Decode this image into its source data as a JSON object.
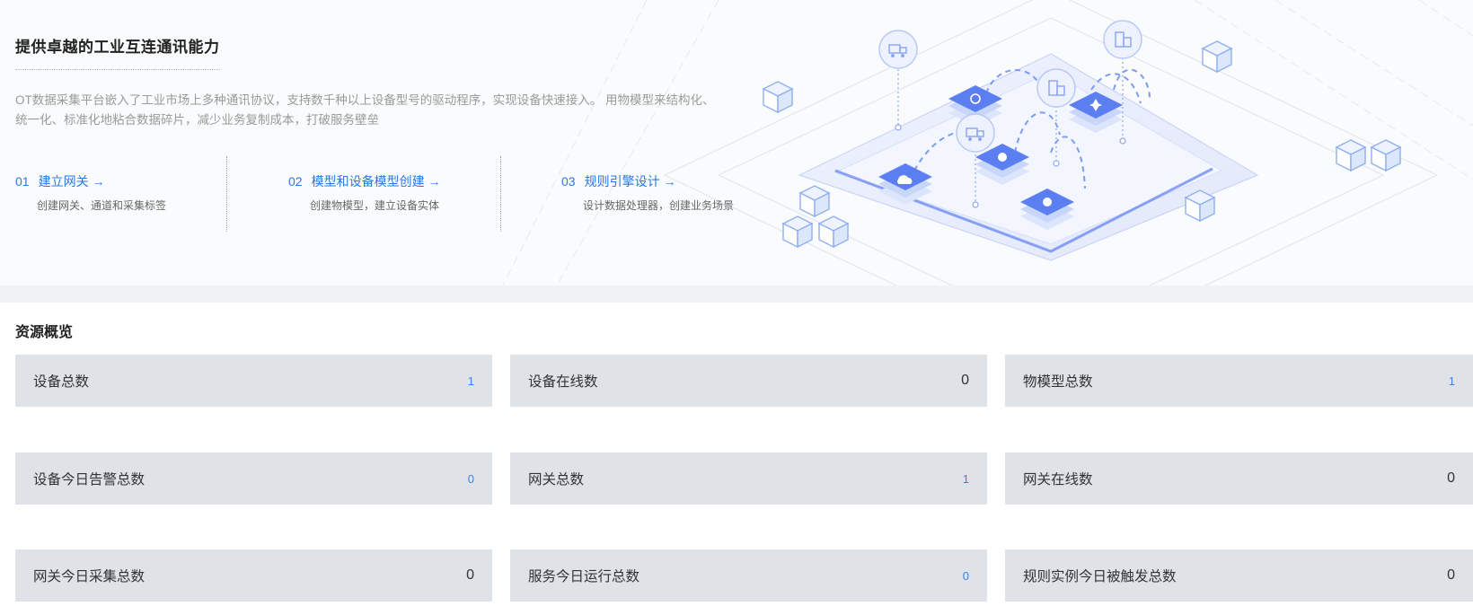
{
  "hero": {
    "title": "提供卓越的工业互连通讯能力",
    "description": "OT数据采集平台嵌入了工业市场上多种通讯协议，支持数千种以上设备型号的驱动程序，实现设备快速接入。 用物模型来结构化、统一化、标准化地粘合数据碎片，减少业务复制成本，打破服务壁垒",
    "steps": [
      {
        "num": "01",
        "title": "建立网关 →",
        "sub": "创建网关、通道和采集标签"
      },
      {
        "num": "02",
        "title": "模型和设备模型创建 →",
        "sub": "创建物模型，建立设备实体"
      },
      {
        "num": "03",
        "title": "规则引擎设计 →",
        "sub": "设计数据处理器，创建业务场景"
      }
    ]
  },
  "overview": {
    "title": "资源概览",
    "cards": [
      {
        "label": "设备总数",
        "value": "1",
        "blue": true
      },
      {
        "label": "设备在线数",
        "value": "0",
        "blue": false
      },
      {
        "label": "物模型总数",
        "value": "1",
        "blue": true
      },
      {
        "label": "设备今日告警总数",
        "value": "0",
        "blue": true
      },
      {
        "label": "网关总数",
        "value": "1",
        "blue": true
      },
      {
        "label": "网关在线数",
        "value": "0",
        "blue": false
      },
      {
        "label": "网关今日采集总数",
        "value": "0",
        "blue": false
      },
      {
        "label": "服务今日运行总数",
        "value": "0",
        "blue": true
      },
      {
        "label": "规则实例今日被触发总数",
        "value": "0",
        "blue": false
      }
    ]
  },
  "colors": {
    "accent": "#2a78e4",
    "card_bg": "#dfe2e6",
    "platform_blue": "#5b7ff0"
  },
  "icons": [
    "truck-icon",
    "building-icon",
    "bell-icon",
    "fan-icon",
    "cloud-icon",
    "gear-icon",
    "cube-icon"
  ]
}
